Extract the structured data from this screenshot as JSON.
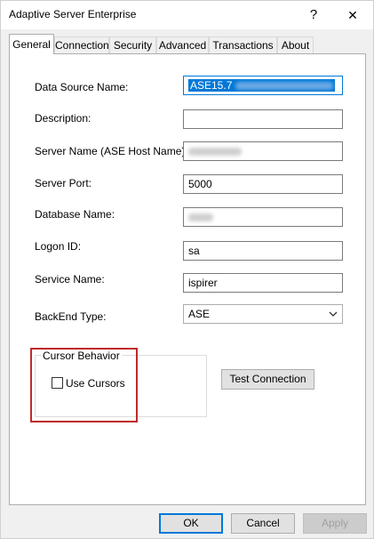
{
  "window": {
    "title": "Adaptive Server Enterprise",
    "help_glyph": "?",
    "close_glyph": "✕"
  },
  "tabs": [
    {
      "label": "General"
    },
    {
      "label": "Connection"
    },
    {
      "label": "Security"
    },
    {
      "label": "Advanced"
    },
    {
      "label": "Transactions"
    },
    {
      "label": "About"
    }
  ],
  "fields": {
    "data_source_name": {
      "label": "Data Source Name:",
      "value": "ASE15.7"
    },
    "description": {
      "label": "Description:",
      "value": ""
    },
    "server_name": {
      "label": "Server Name (ASE Host Name):",
      "value": ""
    },
    "server_port": {
      "label": "Server Port:",
      "value": "5000"
    },
    "database_name": {
      "label": "Database Name:",
      "value": ""
    },
    "logon_id": {
      "label": "Logon ID:",
      "value": "sa"
    },
    "service_name": {
      "label": "Service Name:",
      "value": "ispirer"
    },
    "backend_type": {
      "label": "BackEnd Type:",
      "value": "ASE"
    }
  },
  "cursor_behavior": {
    "group_label": "Cursor Behavior",
    "checkbox_label": "Use Cursors",
    "checked": false
  },
  "buttons": {
    "test_connection": "Test Connection",
    "ok": "OK",
    "cancel": "Cancel",
    "apply": "Apply"
  },
  "colors": {
    "selection": "#0078d7",
    "annotation_box": "#c0292b",
    "default_button_border": "#0078d7"
  }
}
